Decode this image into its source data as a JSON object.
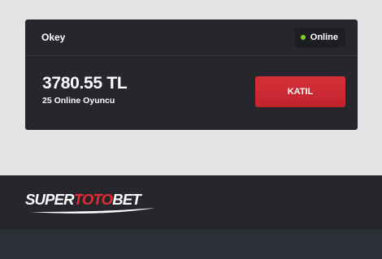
{
  "card": {
    "title": "Okey",
    "status": "Online",
    "status_color": "#7ed321",
    "amount": "3780.55 TL",
    "players": "25 Online Oyuncu",
    "join_label": "KATIL",
    "join_color": "#d12c35"
  },
  "footer": {
    "logo": {
      "part1": "SUPER",
      "part2": "TOTO",
      "part3": "BET",
      "accent_color": "#e52b33"
    }
  }
}
